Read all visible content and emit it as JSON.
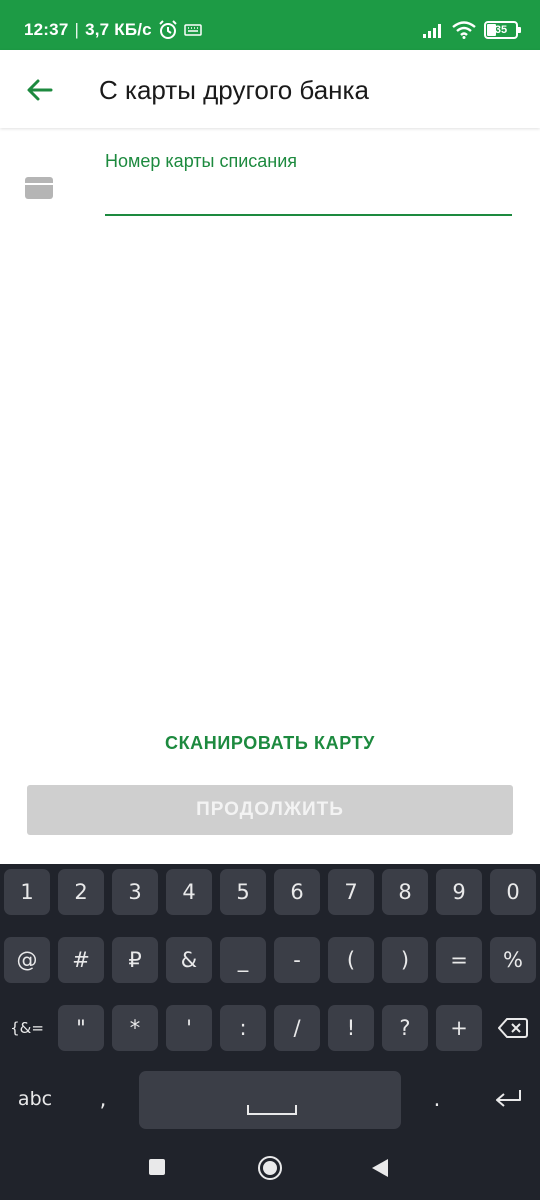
{
  "status_bar": {
    "time": "12:37",
    "network_speed": "3,7 КБ/с",
    "battery": "35"
  },
  "app_bar": {
    "title": "С карты другого банка"
  },
  "form": {
    "card_field_label": "Номер карты списания",
    "card_field_value": ""
  },
  "actions": {
    "scan_label": "СКАНИРОВАТЬ КАРТУ",
    "continue_label": "ПРОДОЛЖИТЬ"
  },
  "keyboard": {
    "row1": [
      "1",
      "2",
      "3",
      "4",
      "5",
      "6",
      "7",
      "8",
      "9",
      "0"
    ],
    "row2": [
      "@",
      "#",
      "₽",
      "&",
      "_",
      "-",
      "(",
      ")",
      "=",
      "%"
    ],
    "row3_mode": "{&=",
    "row3": [
      "\"",
      "*",
      "'",
      ":",
      "/",
      "!",
      "?",
      "+"
    ],
    "abc_label": "abc",
    "comma": ",",
    "period": "."
  },
  "colors": {
    "status_bar": "#1d9b45",
    "accent": "#1d8a3f",
    "disabled_button": "#cfcfcf",
    "keyboard_bg": "#20232b",
    "key_bg": "#3b3e47"
  }
}
